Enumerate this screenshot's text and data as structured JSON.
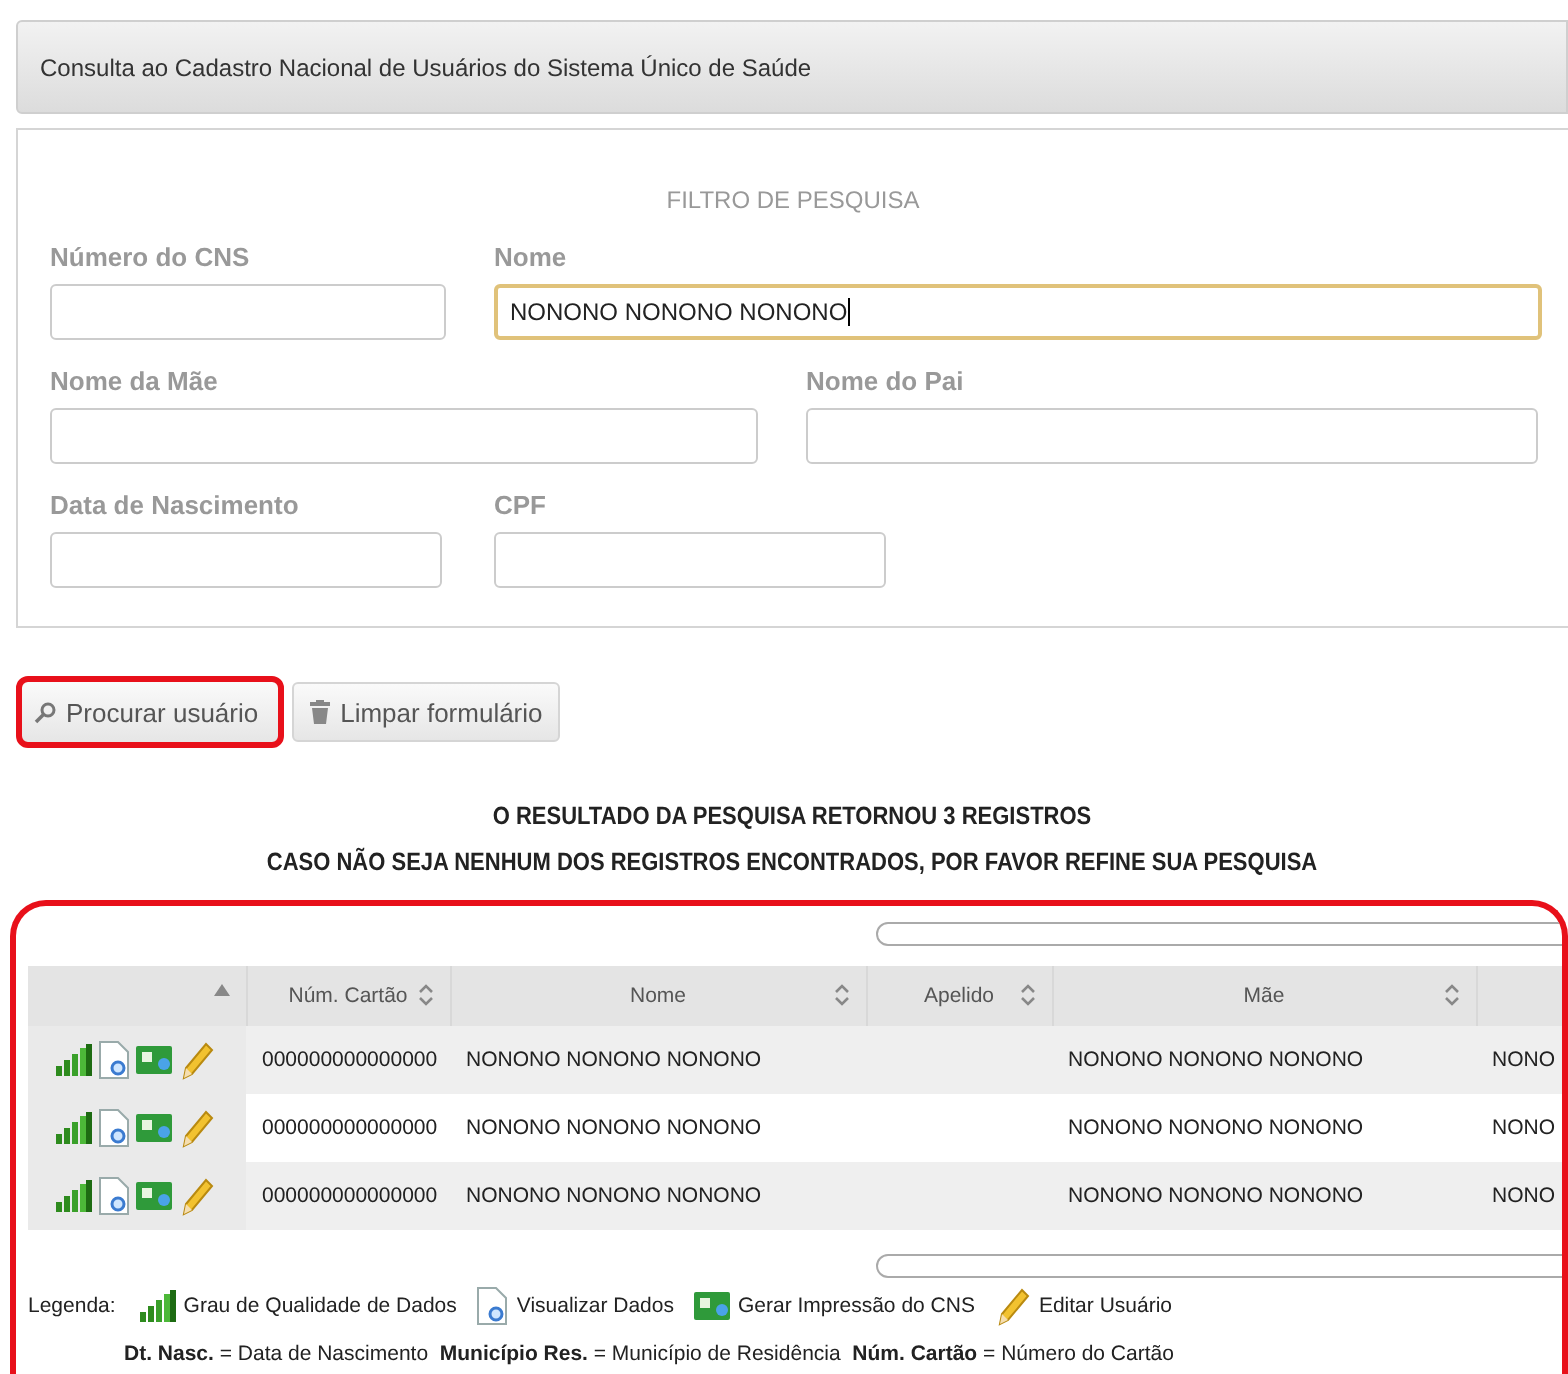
{
  "header": {
    "title": "Consulta ao Cadastro Nacional de Usuários do Sistema Único de Saúde"
  },
  "filter": {
    "title": "FILTRO DE PESQUISA",
    "rows": [
      [
        {
          "label": "Número do CNS"
        },
        {
          "label": "Nome",
          "value": "NONONO NONONO NONONO",
          "focused": true
        }
      ],
      [
        {
          "label": "Nome da Mãe"
        },
        {
          "label": "Nome do Pai"
        }
      ],
      [
        {
          "label": "Data de Nascimento"
        },
        {
          "label": "CPF"
        }
      ]
    ]
  },
  "buttons": [
    {
      "kind": "search",
      "label": "Procurar usuário",
      "highlighted": true
    },
    {
      "kind": "trash",
      "label": "Limpar formulário",
      "highlighted": false
    }
  ],
  "result": {
    "lines": [
      "O RESULTADO DA PESQUISA RETORNOU 3 REGISTROS",
      "CASO NÃO SEJA NENHUM DOS REGISTROS ENCONTRADOS, POR FAVOR REFINE SUA PESQUISA"
    ],
    "highlighted": true
  },
  "table": {
    "columns": [
      {
        "sorted": true
      },
      {
        "label": "Núm. Cartão",
        "sorted": false
      },
      {
        "label": "Nome",
        "sorted": false
      },
      {
        "label": "Apelido",
        "sorted": false
      },
      {
        "label": "Mãe",
        "sorted": false
      }
    ],
    "rows": [
      {
        "card": "000000000000000",
        "name": "NONONO NONONO NONONO",
        "mother": "NONONO NONONO NONONO",
        "column_6": "NONO"
      },
      {
        "card": "000000000000000",
        "name": "NONONO NONONO NONONO",
        "mother": "NONONO NONONO NONONO",
        "column_6": "NONO"
      },
      {
        "card": "000000000000000",
        "name": "NONONO NONONO NONONO",
        "mother": "NONONO NONONO NONONO",
        "column_6": "NONO"
      }
    ]
  },
  "legend": {
    "label": "Legenda:",
    "items": [
      {
        "kind": "quality",
        "text": "Grau de Qualidade de Dados"
      },
      {
        "kind": "view",
        "text": "Visualizar Dados"
      },
      {
        "kind": "print",
        "text": "Gerar Impressão do CNS"
      },
      {
        "kind": "edit",
        "text": "Editar Usuário"
      }
    ],
    "note": "**Dt. Nasc.** = Data de Nascimento  **Município Res.** = Município de Residência  **Núm. Cartão** = Número do Cartão"
  }
}
